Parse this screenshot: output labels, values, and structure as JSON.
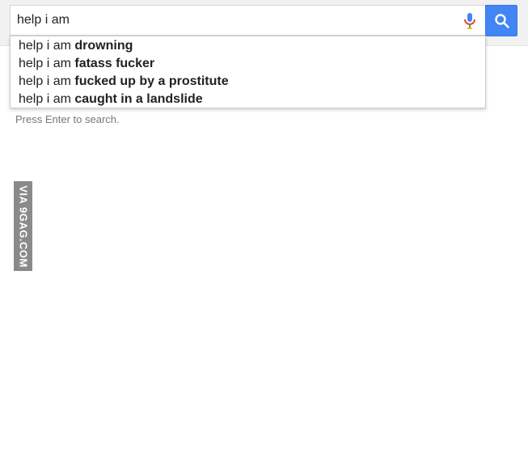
{
  "search": {
    "value": "help i am",
    "icons": {
      "voice": "microphone-icon",
      "submit": "magnifier-icon"
    },
    "colors": {
      "button": "#4285f4"
    }
  },
  "suggestions": [
    {
      "prefix": "help i am ",
      "completion": "drowning"
    },
    {
      "prefix": "help i am ",
      "completion": "fatass fucker"
    },
    {
      "prefix": "help i am ",
      "completion": "fucked up by a prostitute"
    },
    {
      "prefix": "help i am ",
      "completion": "caught in a landslide"
    }
  ],
  "hint": "Press Enter to search.",
  "watermark": "VIA 9GAG.COM"
}
